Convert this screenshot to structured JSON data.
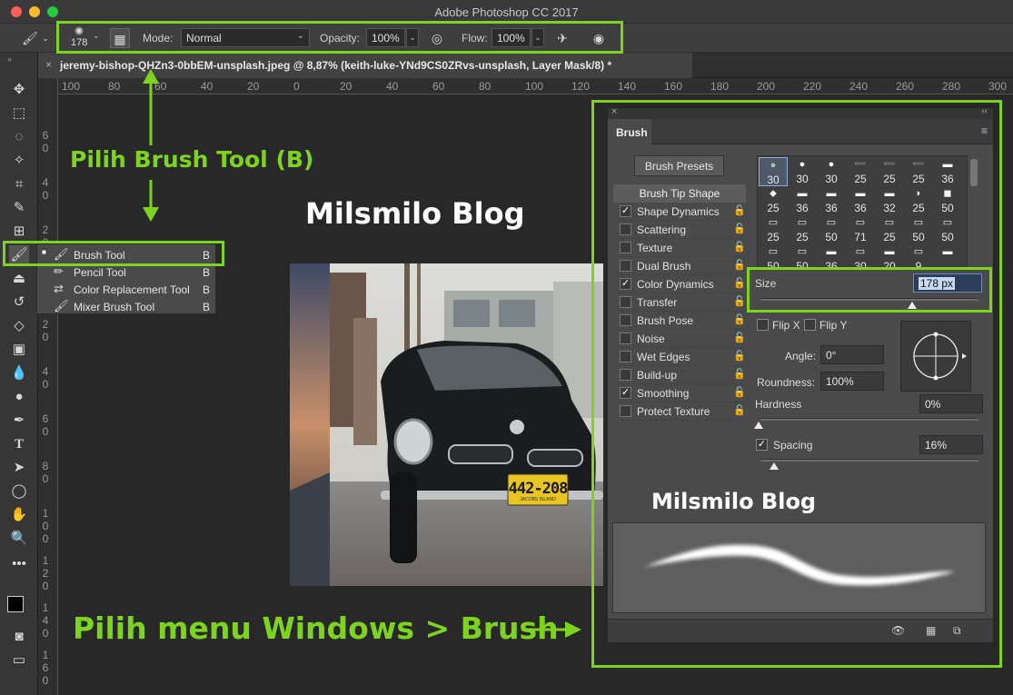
{
  "app": {
    "title": "Adobe Photoshop CC 2017"
  },
  "colors": {
    "accent": "#7ed320",
    "close": "#ff5f57",
    "minimize": "#febc2e",
    "zoom": "#28c840"
  },
  "options_bar": {
    "brush_size": "178",
    "mode_label": "Mode:",
    "mode_value": "Normal",
    "opacity_label": "Opacity:",
    "opacity_value": "100%",
    "flow_label": "Flow:",
    "flow_value": "100%"
  },
  "document": {
    "tab_title": "jeremy-bishop-QHZn3-0bbEM-unsplash.jpeg @ 8,87% (keith-luke-YNd9CS0ZRvs-unsplash, Layer Mask/8) *",
    "close_glyph": "×"
  },
  "ruler": {
    "h_ticks": [
      "100",
      "80",
      "60",
      "40",
      "20",
      "0",
      "20",
      "40",
      "60",
      "80",
      "100",
      "120",
      "140",
      "160",
      "180",
      "200",
      "220",
      "240",
      "260",
      "280",
      "300"
    ],
    "v_ticks": [
      "6\n0",
      "4\n0",
      "2\n0",
      "0",
      "2\n0",
      "4\n0",
      "6\n0",
      "8\n0",
      "1\n0\n0",
      "1\n2\n0",
      "1\n4\n0",
      "1\n6\n0"
    ]
  },
  "flyout": {
    "items": [
      {
        "label": "Brush Tool",
        "shortcut": "B",
        "icon": "brush-icon"
      },
      {
        "label": "Pencil Tool",
        "shortcut": "B",
        "icon": "pencil-icon"
      },
      {
        "label": "Color Replacement Tool",
        "shortcut": "B",
        "icon": "color-replacement-icon"
      },
      {
        "label": "Mixer Brush Tool",
        "shortcut": "B",
        "icon": "mixer-brush-icon"
      }
    ]
  },
  "plate": {
    "line1": "442-208",
    "line2": "JACOBS ISLAND"
  },
  "panel": {
    "tab_label": "Brush",
    "presets_button": "Brush Presets",
    "tip_shape_label": "Brush Tip Shape",
    "options": [
      {
        "label": "Shape Dynamics",
        "checked": true
      },
      {
        "label": "Scattering",
        "checked": false
      },
      {
        "label": "Texture",
        "checked": false
      },
      {
        "label": "Dual Brush",
        "checked": false
      },
      {
        "label": "Color Dynamics",
        "checked": true
      },
      {
        "label": "Transfer",
        "checked": false
      },
      {
        "label": "Brush Pose",
        "checked": false
      },
      {
        "label": "Noise",
        "checked": false
      },
      {
        "label": "Wet Edges",
        "checked": false
      },
      {
        "label": "Build-up",
        "checked": false
      },
      {
        "label": "Smoothing",
        "checked": true
      },
      {
        "label": "Protect Texture",
        "checked": false
      }
    ],
    "tips": [
      "30",
      "30",
      "30",
      "25",
      "25",
      "25",
      "36",
      "25",
      "36",
      "36",
      "36",
      "32",
      "25",
      "50",
      "25",
      "25",
      "50",
      "71",
      "25",
      "50",
      "50",
      "50",
      "50",
      "36",
      "30",
      "20",
      "9",
      ""
    ],
    "size_label": "Size",
    "size_value": "178 px",
    "flip_x": "Flip X",
    "flip_y": "Flip Y",
    "angle_label": "Angle:",
    "angle_value": "0°",
    "roundness_label": "Roundness:",
    "roundness_value": "100%",
    "hardness_label": "Hardness",
    "hardness_value": "0%",
    "spacing_label": "Spacing",
    "spacing_value": "16%"
  },
  "annotations": {
    "pilih_brush": "Pilih Brush Tool (B)",
    "pilih_menu": "Pilih menu Windows > Brush",
    "watermark": "Milsmilo Blog"
  }
}
